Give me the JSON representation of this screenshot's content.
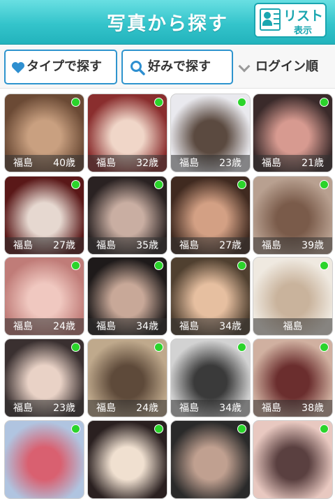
{
  "header": {
    "title": "写真から探す",
    "list_button": {
      "label": "リスト",
      "sub": "表示"
    }
  },
  "filters": {
    "type_label": "タイプで探す",
    "pref_label": "好みで探す",
    "sort_label": "ログイン順"
  },
  "profiles": [
    {
      "city": "福島",
      "age": "40歳",
      "colors": [
        "#6b4a35",
        "#c9a080"
      ]
    },
    {
      "city": "福島",
      "age": "32歳",
      "colors": [
        "#8a2e2e",
        "#f0d6c8"
      ]
    },
    {
      "city": "福島",
      "age": "23歳",
      "colors": [
        "#e9e9ee",
        "#5b4a40"
      ]
    },
    {
      "city": "福島",
      "age": "21歳",
      "colors": [
        "#3a2a2a",
        "#d79a90"
      ]
    },
    {
      "city": "福島",
      "age": "27歳",
      "colors": [
        "#5a1818",
        "#e6d8d0"
      ]
    },
    {
      "city": "福島",
      "age": "35歳",
      "colors": [
        "#2a2222",
        "#c9aea2"
      ]
    },
    {
      "city": "福島",
      "age": "27歳",
      "colors": [
        "#402a20",
        "#d3a084"
      ]
    },
    {
      "city": "福島",
      "age": "39歳",
      "colors": [
        "#b8a090",
        "#7a5b4a"
      ]
    },
    {
      "city": "福島",
      "age": "24歳",
      "colors": [
        "#c07c78",
        "#f0c8c0"
      ]
    },
    {
      "city": "福島",
      "age": "34歳",
      "colors": [
        "#1e1a1a",
        "#c8a898"
      ]
    },
    {
      "city": "福島",
      "age": "34歳",
      "colors": [
        "#504030",
        "#e6bfa0"
      ]
    },
    {
      "city": "福島",
      "age": "",
      "colors": [
        "#efe9e0",
        "#c9b39c"
      ]
    },
    {
      "city": "福島",
      "age": "23歳",
      "colors": [
        "#3a3030",
        "#e9d2c6"
      ]
    },
    {
      "city": "福島",
      "age": "24歳",
      "colors": [
        "#bfa98c",
        "#5e4a3a"
      ]
    },
    {
      "city": "福島",
      "age": "34歳",
      "colors": [
        "#d2d2d2",
        "#3a3a3a"
      ]
    },
    {
      "city": "福島",
      "age": "38歳",
      "colors": [
        "#d0b0a0",
        "#6b2e2e"
      ]
    },
    {
      "city": "",
      "age": "",
      "colors": [
        "#b0c4e0",
        "#d96070"
      ]
    },
    {
      "city": "",
      "age": "",
      "colors": [
        "#2a2020",
        "#f0e0d0"
      ]
    },
    {
      "city": "",
      "age": "",
      "colors": [
        "#2a2a2a",
        "#c0a090"
      ]
    },
    {
      "city": "",
      "age": "",
      "colors": [
        "#e8c8c0",
        "#5a4040"
      ]
    }
  ]
}
